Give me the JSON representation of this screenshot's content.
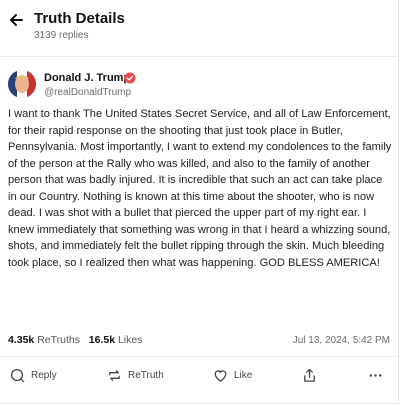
{
  "header": {
    "title": "Truth Details",
    "reply_count": "3139 replies"
  },
  "author": {
    "name": "Donald J. Trump",
    "handle": "@realDonaldTrump",
    "verified_color": "#f04a4a"
  },
  "post": {
    "text": "I want to thank The United States Secret Service, and all of Law Enforcement, for their rapid response on the shooting that just took place in Butler, Pennsylvania. Most importantly, I want to extend my condolences to the family of the person at the Rally who was killed, and also to the family of another person that was badly injured. It is incredible that such an act can take place in our Country. Nothing is known at this time about the shooter, who is now dead. I was shot with a bullet that pierced the upper part of my right ear. I knew immediately that something was wrong in that I heard a whizzing sound, shots, and immediately felt the bullet ripping through the skin. Much bleeding took place, so I realized then what was happening. GOD BLESS AMERICA!",
    "retruths_count": "4.35k",
    "retruths_label": "ReTruths",
    "likes_count": "16.5k",
    "likes_label": "Likes",
    "timestamp": "Jul 13, 2024, 5:42 PM"
  },
  "actions": {
    "reply_label": "Reply",
    "retruth_label": "ReTruth",
    "like_label": "Like"
  },
  "icons": {
    "back": "arrow-left-icon",
    "reply": "comment-icon",
    "retruth": "retruth-icon",
    "like": "heart-icon",
    "share": "share-icon",
    "more": "more-icon"
  }
}
